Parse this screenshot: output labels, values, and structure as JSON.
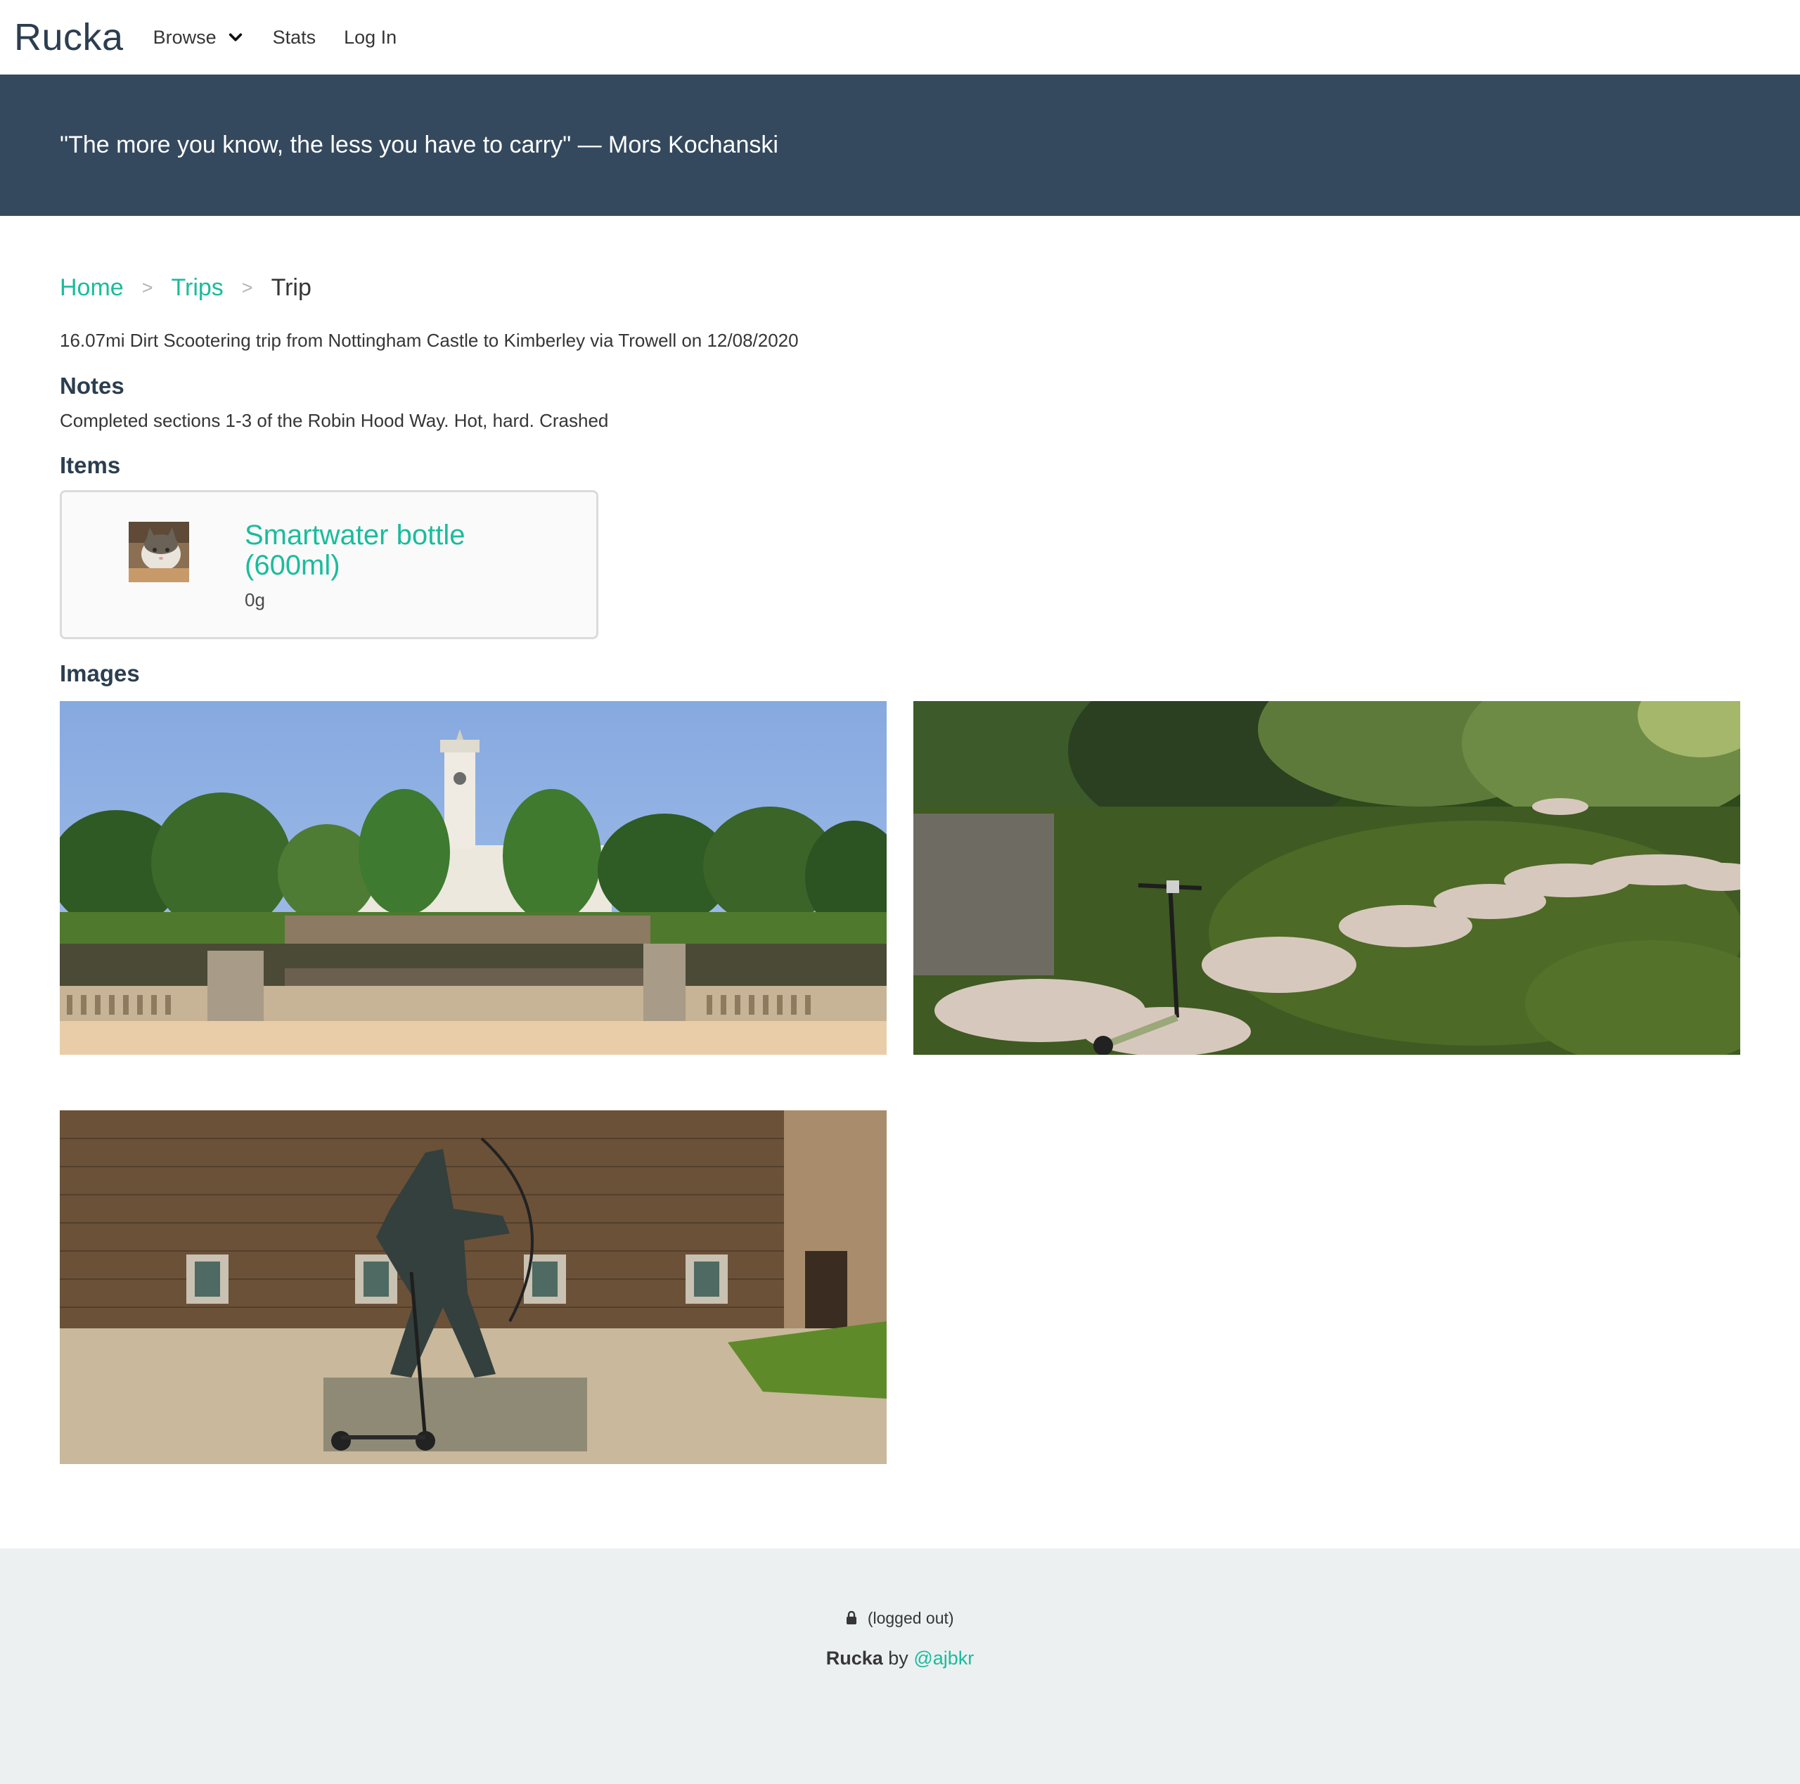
{
  "navbar": {
    "brand": "Rucka",
    "browse_label": "Browse",
    "stats_label": "Stats",
    "login_label": "Log In"
  },
  "hero": {
    "quote": "\"The more you know, the less you have to carry\" — Mors Kochanski"
  },
  "breadcrumb": {
    "home": "Home",
    "trips": "Trips",
    "current": "Trip",
    "separator": ">"
  },
  "trip": {
    "summary": "16.07mi Dirt Scootering trip from Nottingham Castle to Kimberley via Trowell on 12/08/2020"
  },
  "notes": {
    "heading": "Notes",
    "text": "Completed sections 1-3 of the Robin Hood Way. Hot, hard. Crashed"
  },
  "items": {
    "heading": "Items",
    "list": [
      {
        "name": "Smartwater bottle (600ml)",
        "weight": "0g"
      }
    ]
  },
  "images": {
    "heading": "Images"
  },
  "footer": {
    "status": "(logged out)",
    "brand": "Rucka",
    "by": "by",
    "author": "@ajbkr"
  },
  "colors": {
    "accent": "#1abc9c",
    "hero_bg": "#34495e",
    "footer_bg": "#ecf0f1",
    "brand_text": "#2c3e50"
  }
}
